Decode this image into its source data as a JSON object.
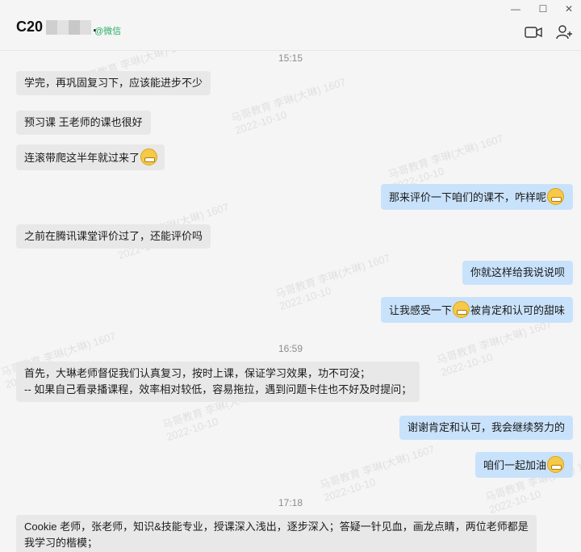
{
  "header": {
    "name": "C20",
    "name_suffix": ".",
    "source": "@微信"
  },
  "window_controls": {
    "minimize": "—",
    "maximize": "☐",
    "close": "✕"
  },
  "messages": [
    {
      "type": "time",
      "text": "15:15"
    },
    {
      "type": "in",
      "text": "学完，再巩固复习下，应该能进步不少"
    },
    {
      "type": "in",
      "text": "预习课 王老师的课也很好"
    },
    {
      "type": "in",
      "text": "连滚带爬这半年就过来了"
    },
    {
      "type": "out",
      "text": "那来评价一下咱们的课不，咋样呢"
    },
    {
      "type": "in",
      "text": "之前在腾讯课堂评价过了，还能评价吗"
    },
    {
      "type": "out",
      "text": "你就这样给我说说呗"
    },
    {
      "type": "out",
      "text_a": "让我感受一下",
      "text_b": "被肯定和认可的甜味"
    },
    {
      "type": "time",
      "text": "16:59"
    },
    {
      "type": "in",
      "line1": "首先，大琳老师督促我们认真复习，按时上课，保证学习效果，功不可没；",
      "line2": "-- 如果自己看录播课程，效率相对较低，容易拖拉，遇到问题卡住也不好及时提问；"
    },
    {
      "type": "out",
      "text": "谢谢肯定和认可，我会继续努力的"
    },
    {
      "type": "out",
      "text": "咱们一起加油"
    },
    {
      "type": "time",
      "text": "17:18"
    },
    {
      "type": "in",
      "line1": "Cookie 老师，张老师，知识&技能专业，授课深入浅出，逐步深入；答疑一针见血，画龙点睛，两位老师都是",
      "line2": "我学习的楷模；"
    }
  ],
  "watermark": {
    "line1": "马哥教育 李琳(大琳) 1607",
    "line2": "2022-10-10"
  }
}
